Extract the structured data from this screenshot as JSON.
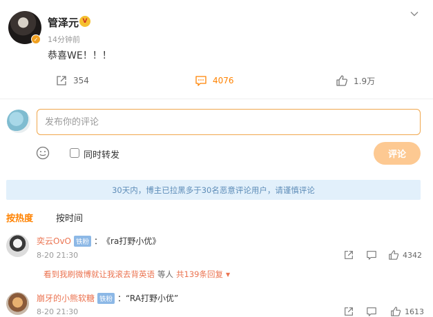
{
  "post": {
    "author": "管泽元",
    "vip_badge": "V",
    "time": "14分钟前",
    "text": "恭喜WE！！！",
    "actions": {
      "share_count": "354",
      "comment_count": "4076",
      "like_count": "1.9万"
    }
  },
  "composer": {
    "placeholder": "发布你的评论",
    "repost_label": "同时转发",
    "submit_label": "评论"
  },
  "notice": "30天内，博主已拉黑多于30名恶意评论用户，请谨慎评论",
  "sort_tabs": {
    "hot": "按热度",
    "time": "按时间"
  },
  "comments": [
    {
      "name": "奕云OvO",
      "badge": "铁粉",
      "separator": "：",
      "text": "《ra打野小优》",
      "time": "8-20 21:30",
      "likes": "4342",
      "reply_preview": "看到我刷微博就让我滚去背英语",
      "reply_meta": "等人",
      "reply_count": "共139条回复",
      "reply_caret": "▼"
    },
    {
      "name": "崩牙的小熊软糖",
      "badge": "铁粉",
      "separator": "：",
      "text": "“RA打野小优”",
      "time": "8-20 21:30",
      "likes": "1613"
    }
  ],
  "colors": {
    "accent": "#ff8200",
    "name_link": "#eb7350",
    "fan_badge": "#8cb8e6",
    "notice_bg": "#e2f0fb"
  }
}
